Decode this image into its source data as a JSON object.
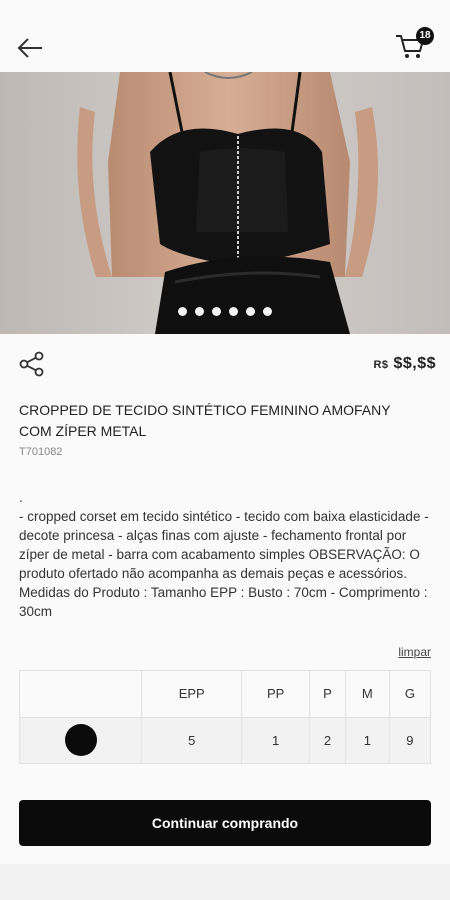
{
  "header": {
    "cart_count": "18"
  },
  "gallery": {
    "total_images": 6,
    "active_index": 0
  },
  "product": {
    "price_currency": "R$",
    "price_value": "$$,$$",
    "title": "CROPPED DE TECIDO SINTÉTICO FEMININO AMOFANY COM ZÍPER METAL",
    "sku": "T701082",
    "description": "- cropped corset em tecido sintético - tecido com baixa elasticidade - decote princesa - alças finas com ajuste - fechamento frontal por zíper de metal - barra com acabamento simples OBSERVAÇÃO: O produto ofertado não acompanha as demais peças e acessórios. Medidas do Produto : Tamanho EPP : Busto : 70cm - Comprimento : 30cm"
  },
  "size_grid": {
    "clear_label": "limpar",
    "sizes": [
      "EPP",
      "PP",
      "P",
      "M",
      "G"
    ],
    "quantities": [
      "5",
      "1",
      "2",
      "1",
      "9"
    ],
    "color": "#0b0b0b"
  },
  "actions": {
    "continue_label": "Continuar comprando"
  }
}
